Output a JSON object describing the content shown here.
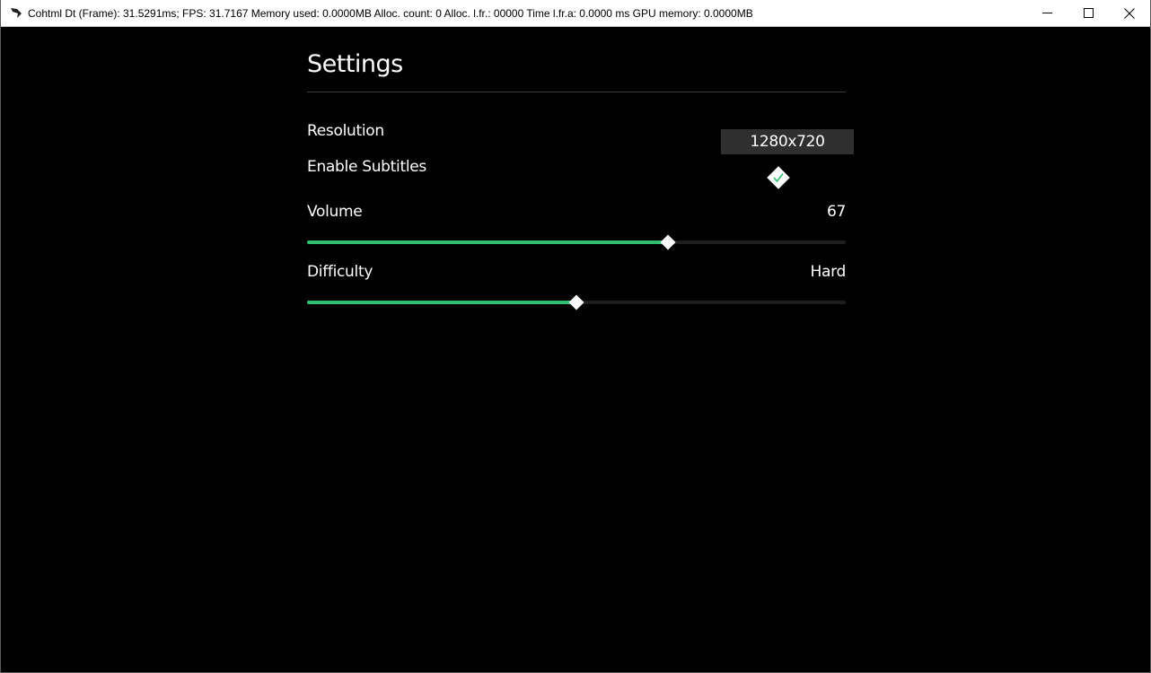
{
  "window": {
    "title": "Cohtml Dt (Frame): 31.5291ms; FPS: 31.7167 Memory used: 0.0000MB Alloc. count: 0 Alloc. l.fr.: 00000 Time l.fr.a: 0.0000 ms GPU memory: 0.0000MB",
    "controls": {
      "minimize_icon": "minimize-icon",
      "maximize_icon": "maximize-icon",
      "close_icon": "close-icon"
    }
  },
  "settings": {
    "title": "Settings",
    "resolution": {
      "label": "Resolution",
      "value": "1280x720"
    },
    "subtitles": {
      "label": "Enable Subtitles",
      "checked": true
    },
    "volume": {
      "label": "Volume",
      "value": "67",
      "level": 67
    },
    "difficulty": {
      "label": "Difficulty",
      "value": "Hard",
      "level": 50
    }
  },
  "colors": {
    "background": "#000000",
    "accent": "#2fbf71",
    "track": "#1e1e1e",
    "dropdown_bg": "#2f2f2f",
    "text": "#ffffff"
  }
}
